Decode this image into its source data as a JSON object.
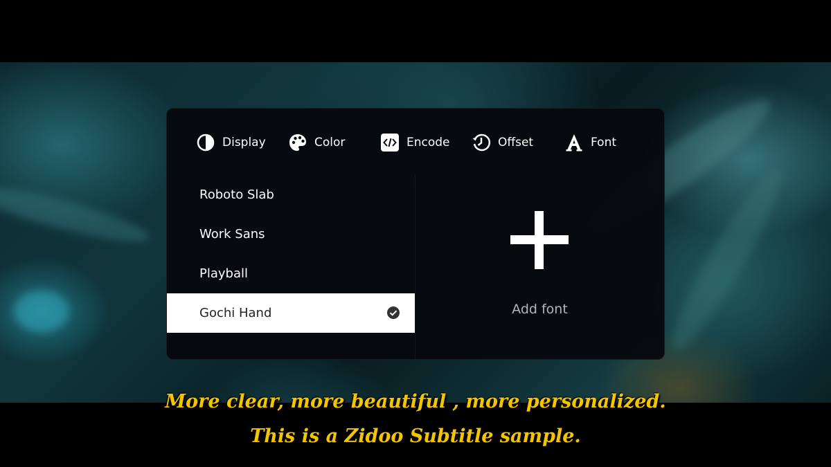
{
  "tabs": [
    {
      "label": "Display",
      "icon": "contrast-icon"
    },
    {
      "label": "Color",
      "icon": "palette-icon"
    },
    {
      "label": "Encode",
      "icon": "code-icon"
    },
    {
      "label": "Offset",
      "icon": "history-icon"
    },
    {
      "label": "Font",
      "icon": "font-icon"
    }
  ],
  "fonts": {
    "items": [
      {
        "label": "Roboto Slab",
        "selected": false
      },
      {
        "label": "Work Sans",
        "selected": false
      },
      {
        "label": "Playball",
        "selected": false
      },
      {
        "label": "Gochi Hand",
        "selected": true
      }
    ],
    "add_label": "Add font"
  },
  "subtitles": {
    "line1": "More clear, more beautiful , more personalized.",
    "line2": "This is a Zidoo Subtitle sample."
  },
  "colors": {
    "panel_bg": "#06080c",
    "selected_bg": "#ffffff",
    "subtitle_color": "#f2c500",
    "add_label_color": "#b5b5b5"
  }
}
